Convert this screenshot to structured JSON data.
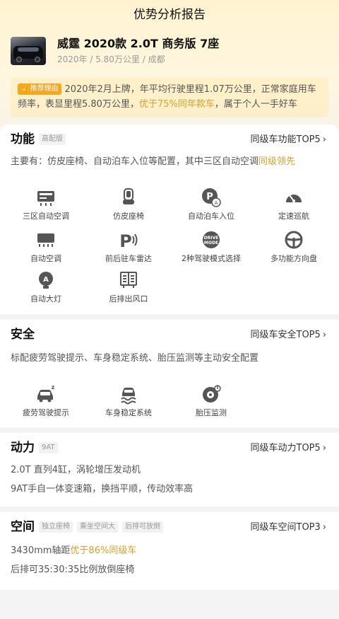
{
  "header": {
    "title": "优势分析报告"
  },
  "car": {
    "name": "威霆 2020款 2.0T 商务版 7座",
    "meta": "2020年 / 5.80万公里 / 成都"
  },
  "reason": {
    "tag": "推荐理由",
    "text_before": "2020年2月上牌，年平均行驶里程1.07万公里，正常家庭用车频率，表显里程5.80万公里，",
    "highlight": "优于75%同年款车",
    "text_after": "，属于个人一手好车"
  },
  "sections": {
    "features": {
      "title": "功能",
      "tag": "高配版",
      "link": "同级车功能TOP5",
      "summary_before": "主要有：仿皮座椅、自动泊车入位等配置，其中三区自动空调",
      "summary_highlight": "同级领先",
      "items": [
        {
          "label": "三区自动空调",
          "icon": "climate-zone-icon"
        },
        {
          "label": "仿皮座椅",
          "icon": "seat-icon"
        },
        {
          "label": "自动泊车入位",
          "icon": "auto-parking-icon"
        },
        {
          "label": "定速巡航",
          "icon": "speedometer-icon"
        },
        {
          "label": "自动空调",
          "icon": "air-conditioner-icon"
        },
        {
          "label": "前后驻车雷达",
          "icon": "parking-radar-icon"
        },
        {
          "label": "2种驾驶模式选择",
          "icon": "drive-mode-icon"
        },
        {
          "label": "多功能方向盘",
          "icon": "steering-wheel-icon"
        },
        {
          "label": "自动大灯",
          "icon": "auto-headlight-icon"
        },
        {
          "label": "后排出风口",
          "icon": "rear-vent-icon"
        }
      ]
    },
    "safety": {
      "title": "安全",
      "link": "同级车安全TOP5",
      "summary": "标配疲劳驾驶提示、车身稳定系统、胎压监测等主动安全配置",
      "items": [
        {
          "label": "疲劳驾驶提示",
          "icon": "fatigue-alert-icon"
        },
        {
          "label": "车身稳定系统",
          "icon": "stability-control-icon"
        },
        {
          "label": "胎压监测",
          "icon": "tire-pressure-icon"
        }
      ]
    },
    "power": {
      "title": "动力",
      "tag": "9AT",
      "link": "同级车动力TOP5",
      "lines": [
        "2.0T 直列4缸，涡轮增压发动机",
        "9AT手自一体变速箱，换挡平顺，传动效率高"
      ]
    },
    "space": {
      "title": "空间",
      "tags": [
        "独立座椅",
        "乘坐空间大",
        "后排可放倒"
      ],
      "link": "同级车空间TOP3",
      "line1_before": "3430mm轴距",
      "line1_highlight": "优于86%同级车",
      "line2": "后排可35:30:35比例放倒座椅"
    }
  },
  "colors": {
    "accent": "#d9a12e",
    "tag_orange": "#f5a623",
    "icon_gray": "#555555"
  }
}
